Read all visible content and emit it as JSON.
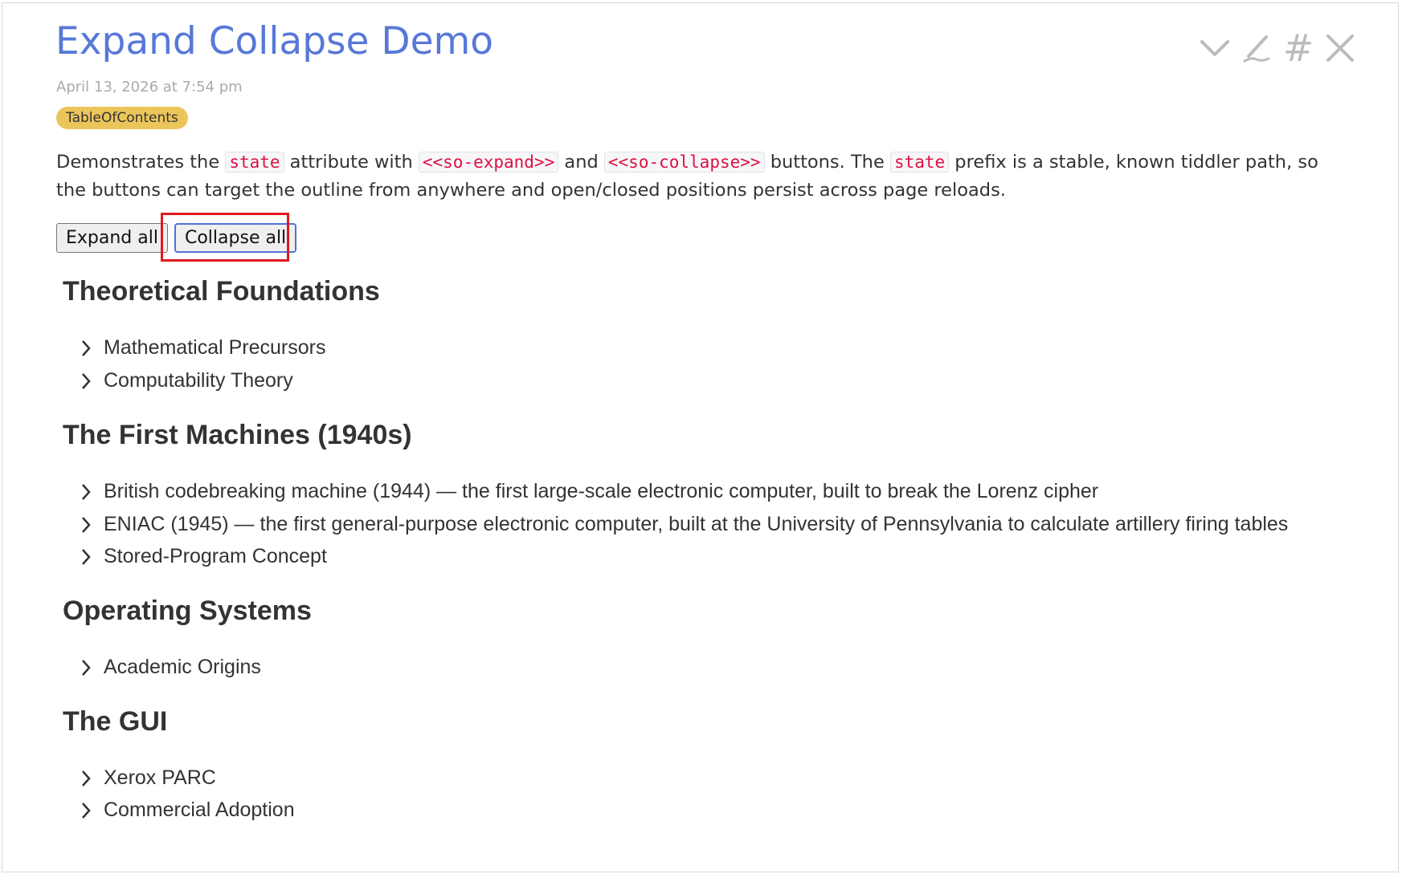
{
  "tiddler": {
    "title": "Expand Collapse Demo",
    "subtitle": "April 13, 2026 at 7:54 pm",
    "tag": "TableOfContents",
    "body": {
      "t1": "Demonstrates the ",
      "code1": "state",
      "t2": " attribute with ",
      "code2": "<<so-expand>>",
      "t3": " and ",
      "code3": "<<so-collapse>>",
      "t4": " buttons. The ",
      "code4": "state",
      "t5": " prefix is a stable, known tiddler path, so the buttons can target the outline from anywhere and open/closed positions persist across page reloads."
    }
  },
  "toolbar": {
    "icons": [
      "chevron-down-icon",
      "pencil-icon",
      "hash-icon",
      "close-icon"
    ],
    "hash_glyph": "#"
  },
  "buttons": {
    "expand_label": "Expand all",
    "collapse_label": "Collapse all"
  },
  "sections": [
    {
      "heading": "Theoretical Foundations",
      "items": [
        "Mathematical Precursors",
        "Computability Theory"
      ]
    },
    {
      "heading": "The First Machines (1940s)",
      "items": [
        "British codebreaking machine (1944) — the first large-scale electronic computer, built to break the Lorenz cipher",
        "ENIAC (1945) — the first general-purpose electronic computer, built at the University of Pennsylvania to calculate artillery firing tables",
        "Stored-Program Concept"
      ]
    },
    {
      "heading": "Operating Systems",
      "items": [
        "Academic Origins"
      ]
    },
    {
      "heading": "The GUI",
      "items": [
        "Xerox PARC",
        "Commercial Adoption"
      ]
    }
  ],
  "colors": {
    "title": "#5778d8",
    "tag": "#ecc55a",
    "code": "#dd1144",
    "highlight": "#e0191e"
  }
}
